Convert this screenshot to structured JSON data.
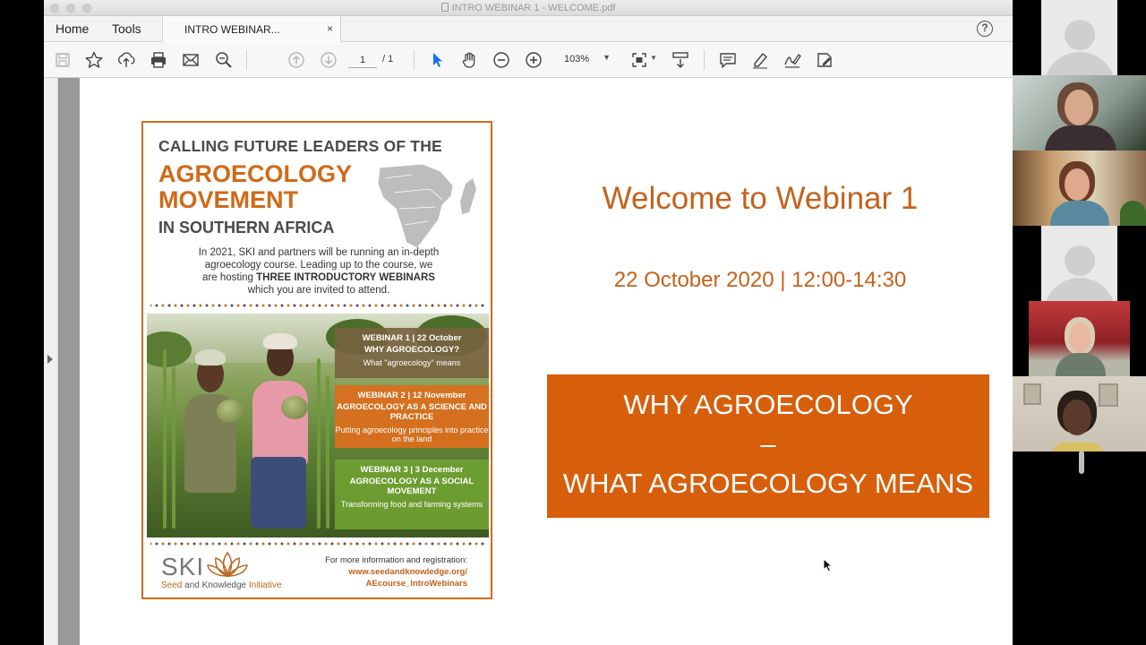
{
  "window": {
    "title": "INTRO WEBINAR 1 - WELCOME.pdf"
  },
  "menu": {
    "home": "Home",
    "tools": "Tools",
    "tab_title": "INTRO WEBINAR...",
    "tab_close": "×",
    "help": "?"
  },
  "toolbar": {
    "page_current": "1",
    "page_total": "/ 1",
    "zoom": "103%",
    "icons": [
      "save-icon",
      "bookmark-star-icon",
      "upload-icon",
      "print-icon",
      "email-icon",
      "search-zoom-icon",
      "page-up-icon",
      "page-down-icon",
      "select-arrow-icon",
      "hand-icon",
      "zoom-out-icon",
      "zoom-in-icon",
      "fit-page-icon",
      "scroll-mode-icon",
      "comment-icon",
      "highlight-pen-icon",
      "sign-icon",
      "edit-pdf-icon"
    ]
  },
  "poster": {
    "line1": "CALLING FUTURE LEADERS OF THE",
    "line2": "AGROECOLOGY",
    "line3": "MOVEMENT",
    "line4": "IN SOUTHERN AFRICA",
    "intro_1": "In 2021, SKI and partners will be running an in-depth",
    "intro_2": "agroecology course. Leading up to the course, we",
    "intro_3a": "are hosting ",
    "intro_3b": "THREE INTRODUCTORY WEBINARS",
    "intro_4": "which you are invited to attend.",
    "webinars": [
      {
        "heading": "WEBINAR 1 | 22 October",
        "title": "WHY AGROECOLOGY?",
        "subtitle": "What \"agroecology\" means"
      },
      {
        "heading": "WEBINAR 2 | 12 November",
        "title": "AGROECOLOGY AS A SCIENCE AND PRACTICE",
        "subtitle": "Putting agroecology principles into practice on the land"
      },
      {
        "heading": "WEBINAR 3 | 3 December",
        "title": "AGROECOLOGY AS A SOCIAL MOVEMENT",
        "subtitle": "Transforming food and farming systems"
      }
    ],
    "logo_text": "SKI",
    "logo_sub_1": "Seed",
    "logo_sub_2": " and Knowledge ",
    "logo_sub_3": "Initiative",
    "info_1": "For more information and registration:",
    "info_2": "www.seedandknowledge.org/",
    "info_3": "AEcourse_IntroWebinars"
  },
  "slide": {
    "welcome": "Welcome to Webinar 1",
    "datetime": "22 October 2020 | 12:00-14:30",
    "banner_1": "WHY AGROECOLOGY",
    "banner_2": "–",
    "banner_3": "WHAT AGROECOLOGY  MEANS"
  },
  "colors": {
    "accent_orange": "#d75e0a",
    "text_orange": "#c5611b",
    "poster_border": "#d06a19"
  },
  "participants": [
    "avatar-placeholder",
    "video",
    "video",
    "avatar-placeholder",
    "video",
    "video"
  ]
}
